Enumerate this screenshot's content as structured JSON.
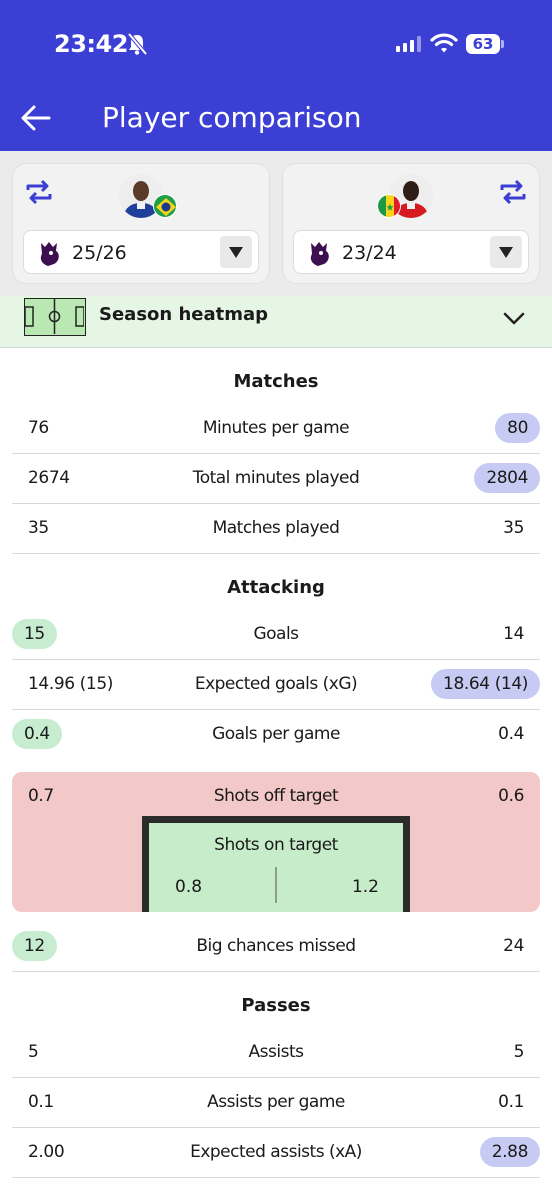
{
  "status": {
    "time": "23:42",
    "battery": "63"
  },
  "header": {
    "title": "Player comparison"
  },
  "players": [
    {
      "season": "25/26"
    },
    {
      "season": "23/24"
    }
  ],
  "heatmap": {
    "label": "Season heatmap"
  },
  "colors": {
    "header": "#3c3fd3",
    "left_highlight": "#c8ecd0",
    "right_highlight": "#c7cbf3",
    "shots_box": "#f3c8c8"
  },
  "sections": {
    "matches": {
      "title": "Matches",
      "rows": [
        {
          "label": "Minutes per game",
          "left": "76",
          "right": "80",
          "better": "right"
        },
        {
          "label": "Total minutes played",
          "left": "2674",
          "right": "2804",
          "better": "right"
        },
        {
          "label": "Matches played",
          "left": "35",
          "right": "35",
          "better": "none"
        }
      ]
    },
    "attacking": {
      "title": "Attacking",
      "rows": [
        {
          "label": "Goals",
          "left": "15",
          "right": "14",
          "better": "left"
        },
        {
          "label": "Expected goals (xG)",
          "left": "14.96 (15)",
          "right": "18.64 (14)",
          "better": "right"
        },
        {
          "label": "Goals per game",
          "left": "0.4",
          "right": "0.4",
          "better": "left"
        }
      ],
      "shots_off": {
        "label": "Shots off target",
        "left": "0.7",
        "right": "0.6"
      },
      "shots_on": {
        "label": "Shots on target",
        "left": "0.8",
        "right": "1.2"
      },
      "big_chances": {
        "label": "Big chances missed",
        "left": "12",
        "right": "24",
        "better": "left"
      }
    },
    "passes": {
      "title": "Passes",
      "rows": [
        {
          "label": "Assists",
          "left": "5",
          "right": "5",
          "better": "none"
        },
        {
          "label": "Assists per game",
          "left": "0.1",
          "right": "0.1",
          "better": "none"
        },
        {
          "label": "Expected assists (xA)",
          "left": "2.00",
          "right": "2.88",
          "better": "right"
        }
      ]
    }
  }
}
